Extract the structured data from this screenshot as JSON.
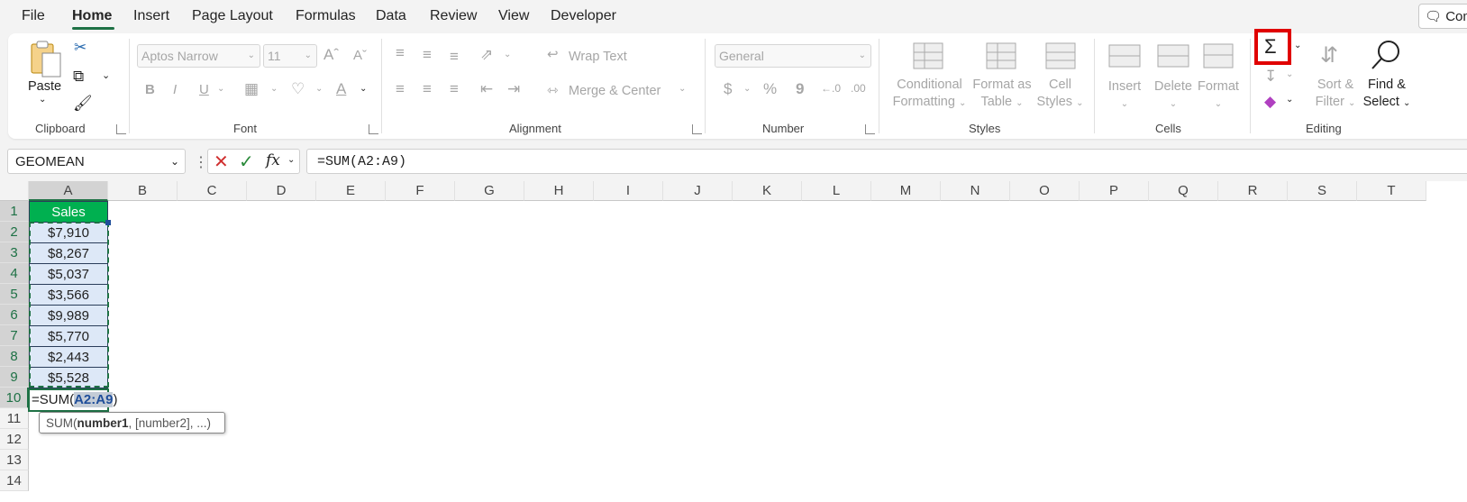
{
  "menu_tabs": [
    "File",
    "Home",
    "Insert",
    "Page Layout",
    "Formulas",
    "Data",
    "Review",
    "View",
    "Developer"
  ],
  "comments_label": "Com",
  "clipboard": {
    "paste": "Paste",
    "group": "Clipboard"
  },
  "font": {
    "name": "Aptos Narrow",
    "size": "11",
    "group": "Font",
    "bold": "B",
    "italic": "I",
    "underline": "U"
  },
  "alignment": {
    "wrap": "Wrap Text",
    "merge": "Merge & Center",
    "group": "Alignment"
  },
  "number": {
    "format": "General",
    "group": "Number",
    "currency": "$",
    "percent": "%",
    "comma": "9"
  },
  "styles": {
    "conditional": [
      "Conditional",
      "Formatting"
    ],
    "format_table": [
      "Format as",
      "Table"
    ],
    "cell_styles": [
      "Cell",
      "Styles"
    ],
    "group": "Styles"
  },
  "cells": {
    "insert": "Insert",
    "delete": "Delete",
    "format": "Format",
    "group": "Cells"
  },
  "editing": {
    "autosum": "Σ",
    "sort": [
      "Sort &",
      "Filter"
    ],
    "find": [
      "Find &",
      "Select"
    ],
    "group": "Editing"
  },
  "formula_bar": {
    "name_box": "GEOMEAN",
    "formula": "=SUM(A2:A9)"
  },
  "columns": [
    "A",
    "B",
    "C",
    "D",
    "E",
    "F",
    "G",
    "H",
    "I",
    "J",
    "K",
    "L",
    "M",
    "N",
    "O",
    "P",
    "Q",
    "R",
    "S",
    "T"
  ],
  "rows": [
    "1",
    "2",
    "3",
    "4",
    "5",
    "6",
    "7",
    "8",
    "9",
    "10",
    "11",
    "12",
    "13",
    "14"
  ],
  "sheet": {
    "header": "Sales",
    "values": [
      "$7,910",
      "$8,267",
      "$5,037",
      "$3,566",
      "$9,989",
      "$5,770",
      "$2,443",
      "$5,528"
    ],
    "edit_prefix": "=SUM(",
    "edit_ref": "A2:A9",
    "edit_suffix": ")"
  },
  "tooltip": {
    "fn": "SUM(",
    "arg1": "number1",
    "rest": ", [number2], ...)"
  },
  "colors": {
    "accent": "#1e7145",
    "header_fill": "#00b050",
    "highlight": "#e00000",
    "ref_blue": "#1f4e9a"
  }
}
